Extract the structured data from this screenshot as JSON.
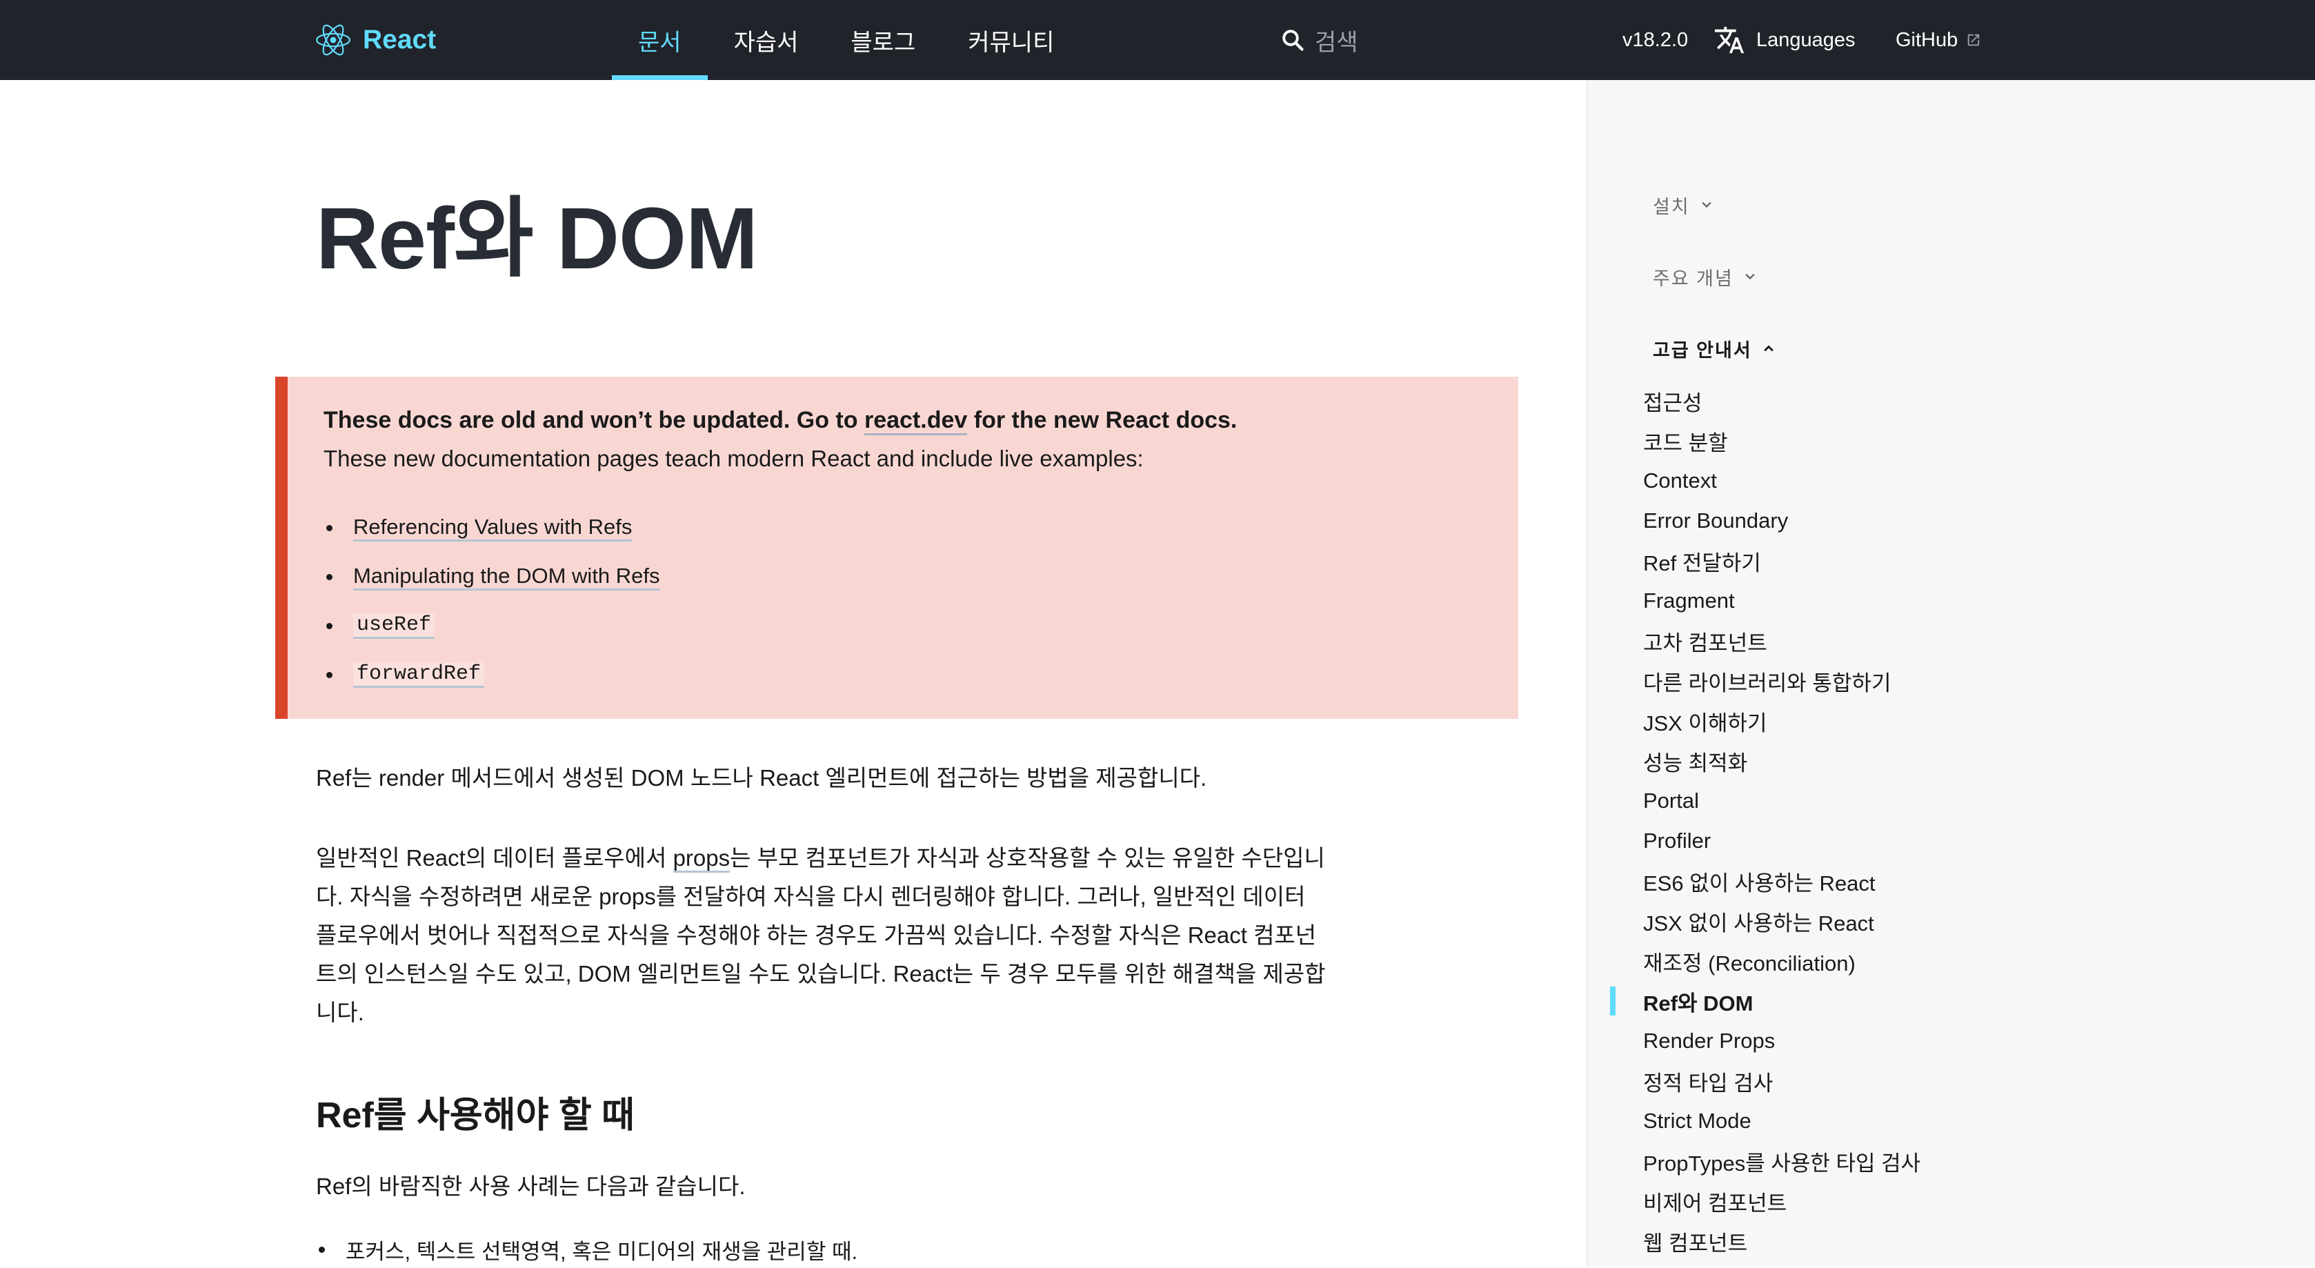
{
  "header": {
    "brand": "React",
    "nav": [
      {
        "label": "문서",
        "active": true
      },
      {
        "label": "자습서",
        "active": false
      },
      {
        "label": "블로그",
        "active": false
      },
      {
        "label": "커뮤니티",
        "active": false
      }
    ],
    "search_placeholder": "검색",
    "version": "v18.2.0",
    "languages": "Languages",
    "github": "GitHub"
  },
  "page": {
    "title": "Ref와 DOM"
  },
  "callout": {
    "title_before": "These docs are old and won’t be updated. Go to ",
    "title_link": "react.dev",
    "title_after": " for the new React docs.",
    "subtitle": "These new documentation pages teach modern React and include live examples:",
    "links": [
      {
        "text": "Referencing Values with Refs",
        "code": false
      },
      {
        "text": "Manipulating the DOM with Refs",
        "code": false
      },
      {
        "text": "useRef",
        "code": true
      },
      {
        "text": "forwardRef",
        "code": true
      }
    ]
  },
  "content": {
    "intro": "Ref는 render 메서드에서 생성된 DOM 노드나 React 엘리먼트에 접근하는 방법을 제공합니다.",
    "para2": {
      "line1_before": "일반적인 React의 데이터 플로우에서 ",
      "line1_link": "props",
      "line1_after": "는 부모 컴포넌트가 자식과 상호작용할 수 있는 유일한 수단입니",
      "line2": "다. 자식을 수정하려면 새로운 props를 전달하여 자식을 다시 렌더링해야 합니다. 그러나, 일반적인 데이터",
      "line3": "플로우에서 벗어나 직접적으로 자식을 수정해야 하는 경우도 가끔씩 있습니다. 수정할 자식은 React 컴포넌",
      "line4": "트의 인스턴스일 수도 있고, DOM 엘리먼트일 수도 있습니다. React는 두 경우 모두를 위한 해결책을 제공합",
      "line5": "니다."
    },
    "section_heading": "Ref를 사용해야 할 때",
    "section_intro": "Ref의 바람직한 사용 사례는 다음과 같습니다.",
    "use_cases": [
      "포커스, 텍스트 선택영역, 혹은 미디어의 재생을 관리할 때."
    ]
  },
  "sidebar": {
    "sections": [
      {
        "label": "설치",
        "expanded": false
      },
      {
        "label": "주요 개념",
        "expanded": false
      },
      {
        "label": "고급 안내서",
        "expanded": true
      }
    ],
    "items": [
      {
        "label": "접근성",
        "active": false
      },
      {
        "label": "코드 분할",
        "active": false
      },
      {
        "label": "Context",
        "active": false
      },
      {
        "label": "Error Boundary",
        "active": false
      },
      {
        "label": "Ref 전달하기",
        "active": false
      },
      {
        "label": "Fragment",
        "active": false
      },
      {
        "label": "고차 컴포넌트",
        "active": false
      },
      {
        "label": "다른 라이브러리와 통합하기",
        "active": false
      },
      {
        "label": "JSX 이해하기",
        "active": false
      },
      {
        "label": "성능 최적화",
        "active": false
      },
      {
        "label": "Portal",
        "active": false
      },
      {
        "label": "Profiler",
        "active": false
      },
      {
        "label": "ES6 없이 사용하는 React",
        "active": false
      },
      {
        "label": "JSX 없이 사용하는 React",
        "active": false
      },
      {
        "label": "재조정 (Reconciliation)",
        "active": false
      },
      {
        "label": "Ref와 DOM",
        "active": true
      },
      {
        "label": "Render Props",
        "active": false
      },
      {
        "label": "정적 타입 검사",
        "active": false
      },
      {
        "label": "Strict Mode",
        "active": false
      },
      {
        "label": "PropTypes를 사용한 타입 검사",
        "active": false
      },
      {
        "label": "비제어 컴포넌트",
        "active": false
      },
      {
        "label": "웹 컴포넌트",
        "active": false
      }
    ]
  },
  "colors": {
    "nav_bg": "#20232a",
    "accent": "#61dafb",
    "callout_bg": "#f8d7d3",
    "callout_border": "#d9442b",
    "sidebar_bg": "#f7f7f7"
  }
}
